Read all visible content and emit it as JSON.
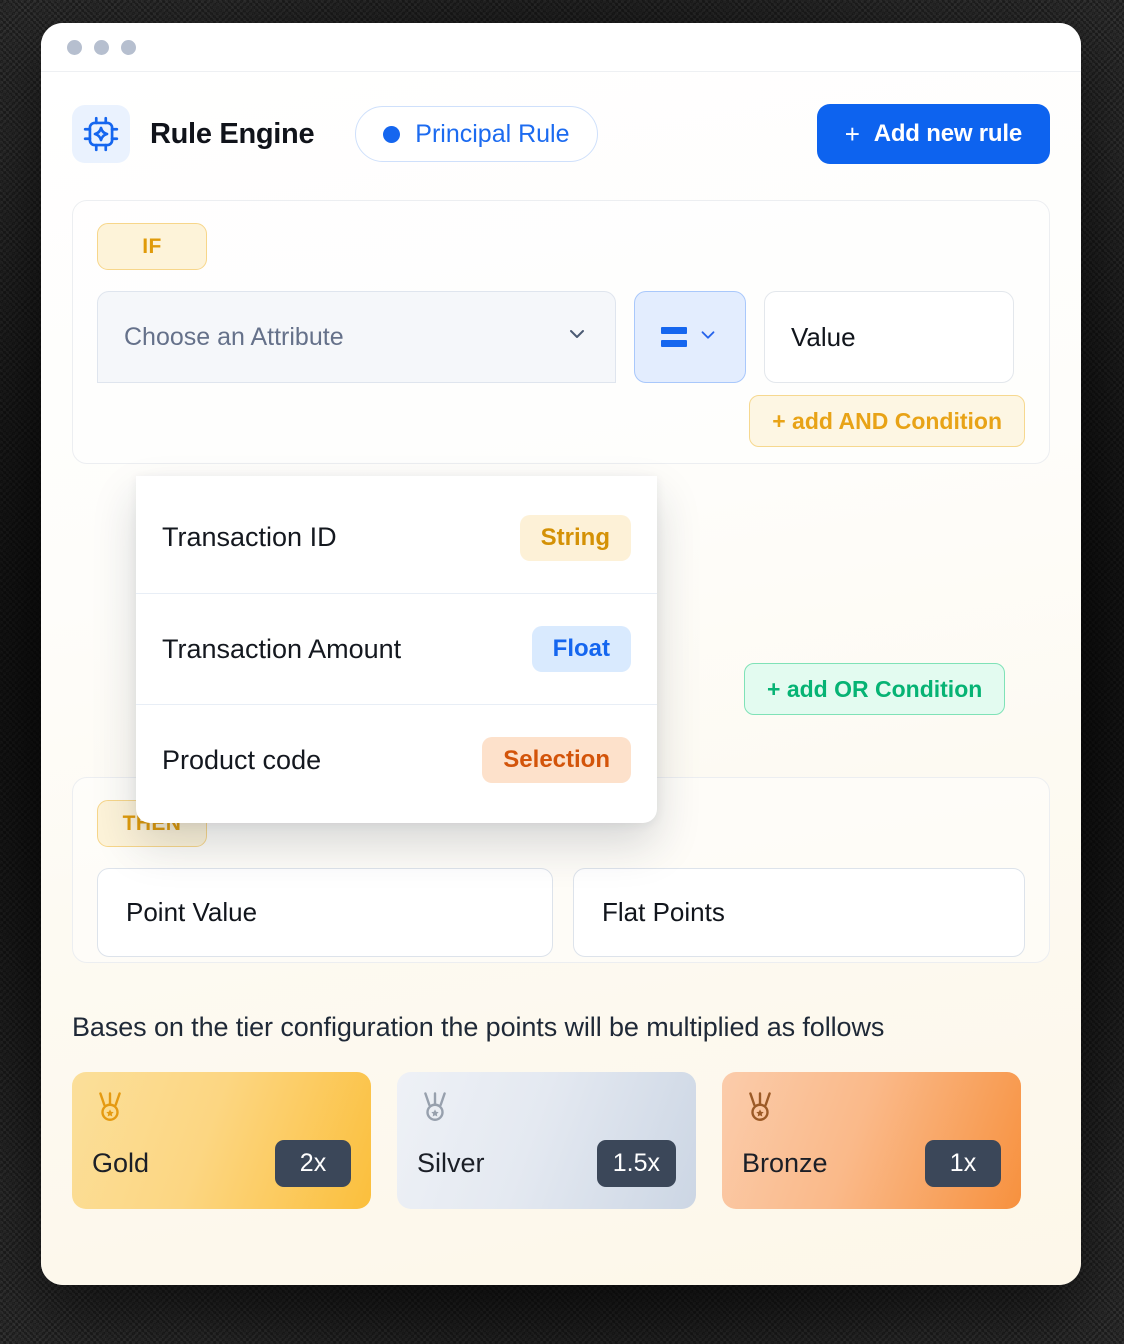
{
  "window": {
    "traffic_lights": [
      "close",
      "minimize",
      "maximize"
    ]
  },
  "header": {
    "app_icon": "cpu-sparkle-icon",
    "title": "Rule Engine",
    "rule_pill": {
      "label": "Principal Rule",
      "status_color": "#1566ef"
    },
    "add_rule_button": {
      "plus": "+",
      "label": "Add new rule"
    }
  },
  "if_section": {
    "keyword": "IF",
    "attribute_select": {
      "placeholder": "Choose an Attribute",
      "chevron": "chevron-down-icon"
    },
    "operator_select": {
      "glyph": "equals-icon",
      "value": "=",
      "chevron": "chevron-down-icon"
    },
    "value_input": {
      "placeholder": "Value",
      "value": ""
    },
    "add_and_condition": "+ add AND Condition",
    "add_or_condition": "+ add OR Condition"
  },
  "attribute_dropdown": {
    "options": [
      {
        "label": "Transaction ID",
        "type": "String",
        "type_class": "badge-string"
      },
      {
        "label": "Transaction Amount",
        "type": "Float",
        "type_class": "badge-float"
      },
      {
        "label": "Product code",
        "type": "Selection",
        "type_class": "badge-selection"
      }
    ]
  },
  "then_section": {
    "keyword": "THEN",
    "point_value": {
      "placeholder": "Point Value",
      "value": ""
    },
    "flat_points": {
      "placeholder": "Flat Points",
      "value": ""
    }
  },
  "tier_section": {
    "note": "Bases on the tier configuration the points will be multiplied as follows",
    "tiers": [
      {
        "name": "Gold",
        "multiplier": "2x",
        "icon": "medal-icon",
        "class": "tier-gold",
        "icon_color": "#e59a11"
      },
      {
        "name": "Silver",
        "multiplier": "1.5x",
        "icon": "medal-icon",
        "class": "tier-silver",
        "icon_color": "#97a0ad"
      },
      {
        "name": "Bronze",
        "multiplier": "1x",
        "icon": "medal-icon",
        "class": "tier-bronze",
        "icon_color": "#9c5a26"
      }
    ]
  },
  "colors": {
    "accent_blue": "#0d63ef",
    "warning_yellow": "#e8a317",
    "success_green": "#06b374",
    "chip_dark": "#3b4759"
  }
}
